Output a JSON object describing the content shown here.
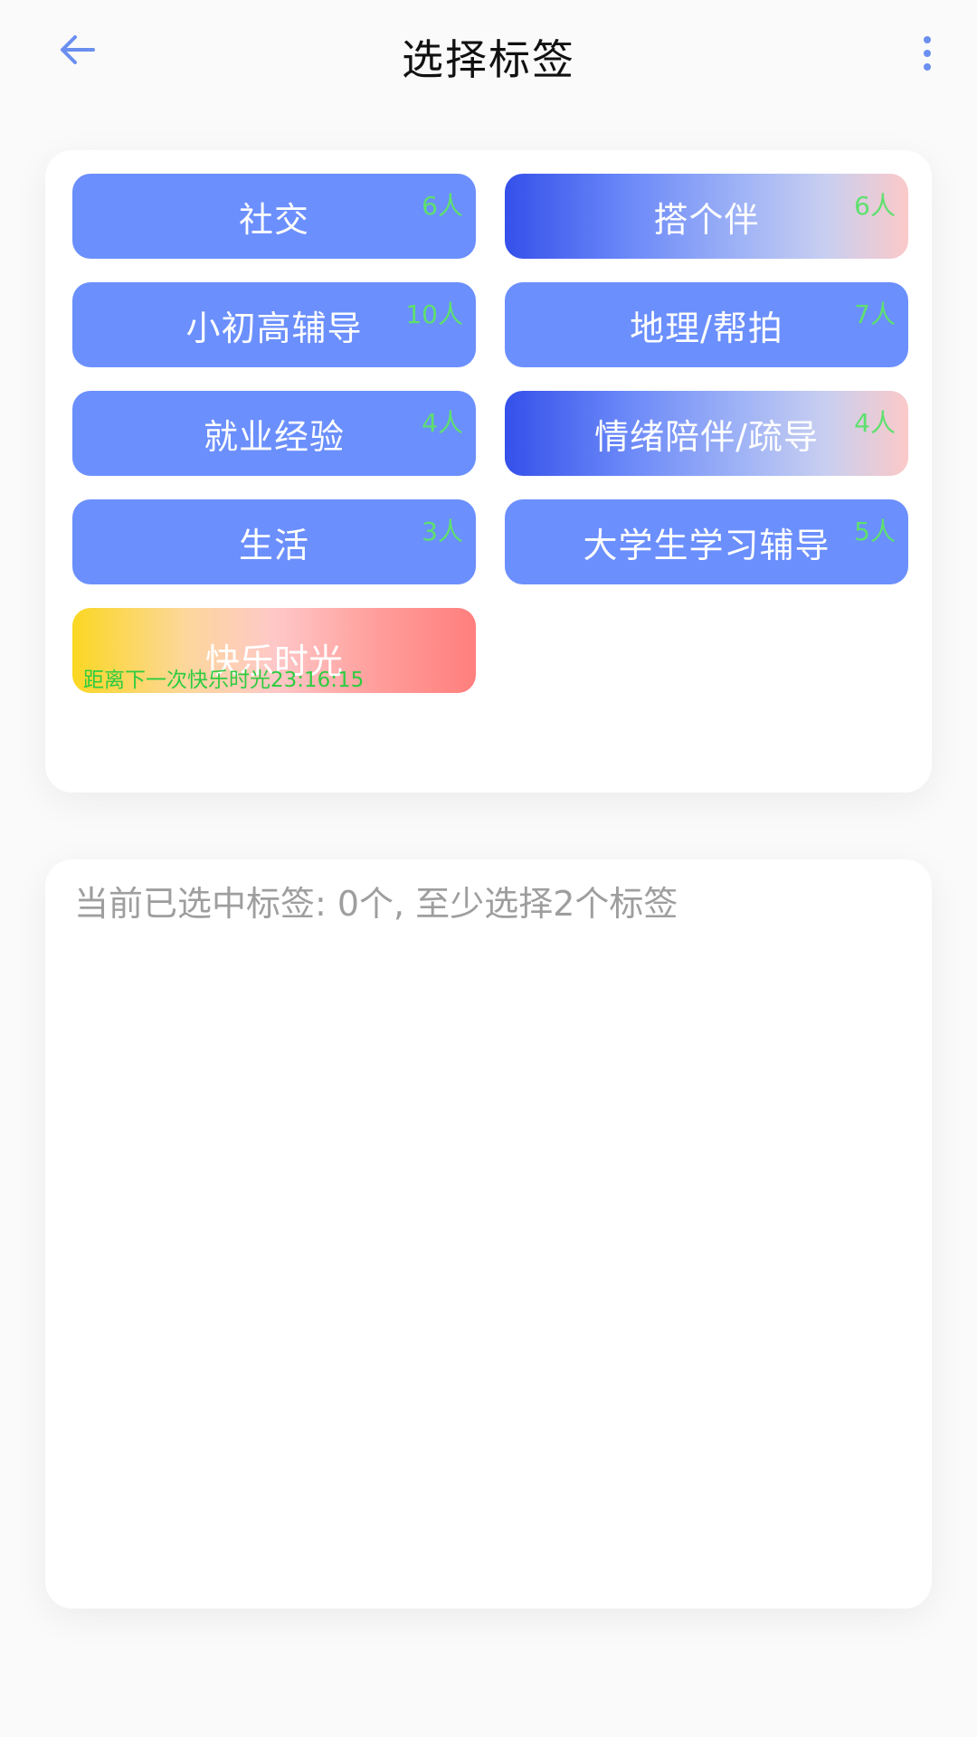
{
  "header": {
    "title": "选择标签",
    "back_icon": "arrow-left-icon",
    "more_icon": "more-vertical-icon",
    "accent_color": "#6b8ff0"
  },
  "tags": [
    {
      "label": "社交",
      "count": "6人",
      "style": "plain"
    },
    {
      "label": "搭个伴",
      "count": "6人",
      "style": "gradient-blue"
    },
    {
      "label": "小初高辅导",
      "count": "10人",
      "style": "plain"
    },
    {
      "label": "地理/帮拍",
      "count": "7人",
      "style": "plain"
    },
    {
      "label": "就业经验",
      "count": "4人",
      "style": "plain"
    },
    {
      "label": "情绪陪伴/疏导",
      "count": "4人",
      "style": "gradient-blue"
    },
    {
      "label": "生活",
      "count": "3人",
      "style": "plain"
    },
    {
      "label": "大学生学习辅导",
      "count": "5人",
      "style": "plain"
    }
  ],
  "happy_time": {
    "label": "快乐时光",
    "countdown": "距离下一次快乐时光23:16:15"
  },
  "selected": {
    "hint": "当前已选中标签: 0个, 至少选择2个标签"
  },
  "colors": {
    "tag_blue": "#6b8ffd",
    "count_green": "#5ee06e",
    "countdown_green": "#2ecc40"
  }
}
